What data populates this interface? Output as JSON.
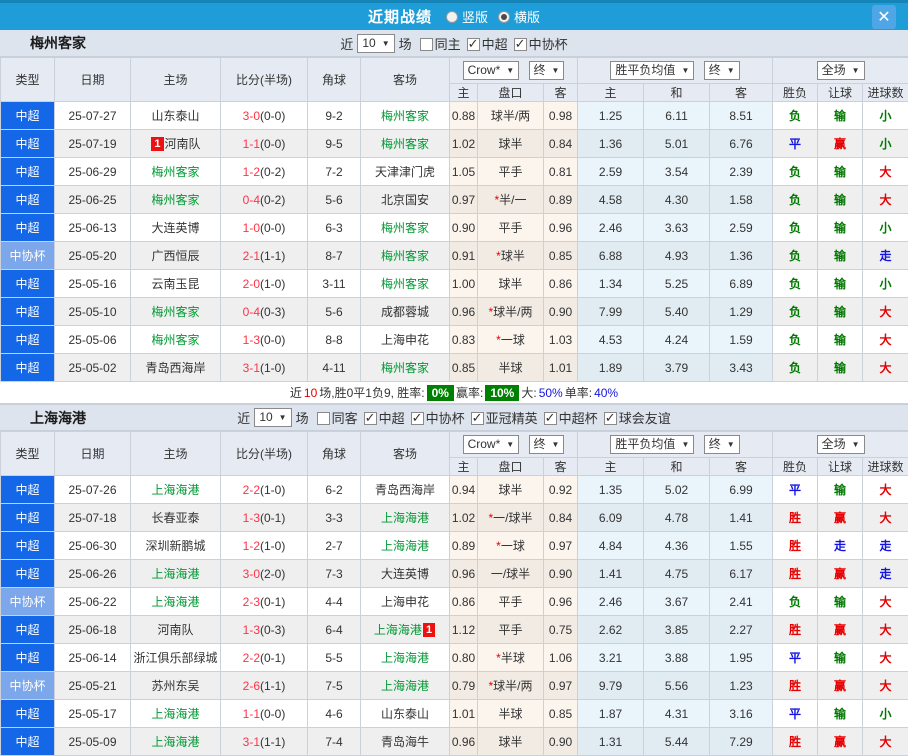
{
  "titlebar": {
    "title": "近期战绩",
    "radios": [
      {
        "label": "竖版",
        "checked": false
      },
      {
        "label": "横版",
        "checked": true
      }
    ],
    "close_glyph": "✕"
  },
  "header": {
    "cols": [
      "类型",
      "日期",
      "主场",
      "比分(半场)",
      "角球",
      "客场"
    ],
    "selects": {
      "company": "Crow*",
      "final1": "终",
      "avg": "胜平负均值",
      "final2": "终",
      "scope": "全场"
    },
    "sub": [
      "主",
      "盘口",
      "客",
      "主",
      "和",
      "客",
      "胜负",
      "让球",
      "进球数"
    ]
  },
  "league_styles": {
    "中超": "league",
    "中协杯": "cup"
  },
  "result_colors": {
    "胜": "#E60000",
    "平": "#1414E0",
    "负": "#007800",
    "赢": "#E60000",
    "输": "#007800",
    "走": "#1414E0",
    "大": "#E60000",
    "小": "#007800"
  },
  "sections": [
    {
      "team": "梅州客家",
      "filters": {
        "near": "近",
        "count": "10",
        "games": "场",
        "checkboxes": [
          {
            "label": "同主",
            "checked": false
          },
          {
            "label": "中超",
            "checked": true
          },
          {
            "label": "中协杯",
            "checked": true
          }
        ]
      },
      "rows": [
        {
          "type": "中超",
          "date": "25-07-27",
          "home": {
            "name": "山东泰山",
            "green": false
          },
          "score": "3-0(0-0)",
          "corner": "9-2",
          "away": {
            "name": "梅州客家",
            "green": true
          },
          "o1": "0.88",
          "pan": "球半/两",
          "o2": "0.98",
          "a1": "1.25",
          "a2": "6.11",
          "a3": "8.51",
          "r1": "负",
          "r2": "输",
          "r3": "小"
        },
        {
          "type": "中超",
          "date": "25-07-19",
          "home": {
            "name": "河南队",
            "green": false,
            "card": "1",
            "card_pos": "before"
          },
          "score": "1-1(0-0)",
          "corner": "9-5",
          "away": {
            "name": "梅州客家",
            "green": true
          },
          "o1": "1.02",
          "pan": "球半",
          "o2": "0.84",
          "a1": "1.36",
          "a2": "5.01",
          "a3": "6.76",
          "r1": "平",
          "r2": "赢",
          "r3": "小"
        },
        {
          "type": "中超",
          "date": "25-06-29",
          "home": {
            "name": "梅州客家",
            "green": true
          },
          "score": "1-2(0-2)",
          "corner": "7-2",
          "away": {
            "name": "天津津门虎",
            "green": false
          },
          "o1": "1.05",
          "pan": "平手",
          "o2": "0.81",
          "a1": "2.59",
          "a2": "3.54",
          "a3": "2.39",
          "r1": "负",
          "r2": "输",
          "r3": "大"
        },
        {
          "type": "中超",
          "date": "25-06-25",
          "home": {
            "name": "梅州客家",
            "green": true
          },
          "score": "0-4(0-2)",
          "corner": "5-6",
          "away": {
            "name": "北京国安",
            "green": false
          },
          "o1": "0.97",
          "pan": "*半/一",
          "o2": "0.89",
          "a1": "4.58",
          "a2": "4.30",
          "a3": "1.58",
          "r1": "负",
          "r2": "输",
          "r3": "大"
        },
        {
          "type": "中超",
          "date": "25-06-13",
          "home": {
            "name": "大连英博",
            "green": false
          },
          "score": "1-0(0-0)",
          "corner": "6-3",
          "away": {
            "name": "梅州客家",
            "green": true
          },
          "o1": "0.90",
          "pan": "平手",
          "o2": "0.96",
          "a1": "2.46",
          "a2": "3.63",
          "a3": "2.59",
          "r1": "负",
          "r2": "输",
          "r3": "小"
        },
        {
          "type": "中协杯",
          "date": "25-05-20",
          "home": {
            "name": "广西恒辰",
            "green": false
          },
          "score": "2-1(1-1)",
          "corner": "8-7",
          "away": {
            "name": "梅州客家",
            "green": true
          },
          "o1": "0.91",
          "pan": "*球半",
          "o2": "0.85",
          "a1": "6.88",
          "a2": "4.93",
          "a3": "1.36",
          "r1": "负",
          "r2": "输",
          "r3": "走"
        },
        {
          "type": "中超",
          "date": "25-05-16",
          "home": {
            "name": "云南玉昆",
            "green": false
          },
          "score": "2-0(1-0)",
          "corner": "3-11",
          "away": {
            "name": "梅州客家",
            "green": true
          },
          "o1": "1.00",
          "pan": "球半",
          "o2": "0.86",
          "a1": "1.34",
          "a2": "5.25",
          "a3": "6.89",
          "r1": "负",
          "r2": "输",
          "r3": "小"
        },
        {
          "type": "中超",
          "date": "25-05-10",
          "home": {
            "name": "梅州客家",
            "green": true
          },
          "score": "0-4(0-3)",
          "corner": "5-6",
          "away": {
            "name": "成都蓉城",
            "green": false
          },
          "o1": "0.96",
          "pan": "*球半/两",
          "o2": "0.90",
          "a1": "7.99",
          "a2": "5.40",
          "a3": "1.29",
          "r1": "负",
          "r2": "输",
          "r3": "大"
        },
        {
          "type": "中超",
          "date": "25-05-06",
          "home": {
            "name": "梅州客家",
            "green": true
          },
          "score": "1-3(0-0)",
          "corner": "8-8",
          "away": {
            "name": "上海申花",
            "green": false
          },
          "o1": "0.83",
          "pan": "*一球",
          "o2": "1.03",
          "a1": "4.53",
          "a2": "4.24",
          "a3": "1.59",
          "r1": "负",
          "r2": "输",
          "r3": "大"
        },
        {
          "type": "中超",
          "date": "25-05-02",
          "home": {
            "name": "青岛西海岸",
            "green": false
          },
          "score": "3-1(1-0)",
          "corner": "4-11",
          "away": {
            "name": "梅州客家",
            "green": true
          },
          "o1": "0.85",
          "pan": "半球",
          "o2": "1.01",
          "a1": "1.89",
          "a2": "3.79",
          "a3": "3.43",
          "r1": "负",
          "r2": "输",
          "r3": "大"
        }
      ],
      "summary": {
        "t1": "近",
        "t2": "10",
        "t3": "场,胜0平1负9, 胜率:",
        "rate1": "0%",
        "t4": "赢率:",
        "rate2": "10%",
        "t5": "大:",
        "rate3": "50%",
        "t6": "单率:",
        "rate4": "40%"
      }
    },
    {
      "team": "上海海港",
      "filters": {
        "near": "近",
        "count": "10",
        "games": "场",
        "checkboxes": [
          {
            "label": "同客",
            "checked": false
          },
          {
            "label": "中超",
            "checked": true
          },
          {
            "label": "中协杯",
            "checked": true
          },
          {
            "label": "亚冠精英",
            "checked": true
          },
          {
            "label": "中超杯",
            "checked": true
          },
          {
            "label": "球会友谊",
            "checked": true
          }
        ]
      },
      "rows": [
        {
          "type": "中超",
          "date": "25-07-26",
          "home": {
            "name": "上海海港",
            "green": true
          },
          "score": "2-2(1-0)",
          "corner": "6-2",
          "away": {
            "name": "青岛西海岸",
            "green": false
          },
          "o1": "0.94",
          "pan": "球半",
          "o2": "0.92",
          "a1": "1.35",
          "a2": "5.02",
          "a3": "6.99",
          "r1": "平",
          "r2": "输",
          "r3": "大"
        },
        {
          "type": "中超",
          "date": "25-07-18",
          "home": {
            "name": "长春亚泰",
            "green": false
          },
          "score": "1-3(0-1)",
          "corner": "3-3",
          "away": {
            "name": "上海海港",
            "green": true
          },
          "o1": "1.02",
          "pan": "*一/球半",
          "o2": "0.84",
          "a1": "6.09",
          "a2": "4.78",
          "a3": "1.41",
          "r1": "胜",
          "r2": "赢",
          "r3": "大"
        },
        {
          "type": "中超",
          "date": "25-06-30",
          "home": {
            "name": "深圳新鹏城",
            "green": false
          },
          "score": "1-2(1-0)",
          "corner": "2-7",
          "away": {
            "name": "上海海港",
            "green": true
          },
          "o1": "0.89",
          "pan": "*一球",
          "o2": "0.97",
          "a1": "4.84",
          "a2": "4.36",
          "a3": "1.55",
          "r1": "胜",
          "r2": "走",
          "r3": "走"
        },
        {
          "type": "中超",
          "date": "25-06-26",
          "home": {
            "name": "上海海港",
            "green": true
          },
          "score": "3-0(2-0)",
          "corner": "7-3",
          "away": {
            "name": "大连英博",
            "green": false
          },
          "o1": "0.96",
          "pan": "一/球半",
          "o2": "0.90",
          "a1": "1.41",
          "a2": "4.75",
          "a3": "6.17",
          "r1": "胜",
          "r2": "赢",
          "r3": "走"
        },
        {
          "type": "中协杯",
          "date": "25-06-22",
          "home": {
            "name": "上海海港",
            "green": true
          },
          "score": "2-3(0-1)",
          "corner": "4-4",
          "away": {
            "name": "上海申花",
            "green": false
          },
          "o1": "0.86",
          "pan": "平手",
          "o2": "0.96",
          "a1": "2.46",
          "a2": "3.67",
          "a3": "2.41",
          "r1": "负",
          "r2": "输",
          "r3": "大"
        },
        {
          "type": "中超",
          "date": "25-06-18",
          "home": {
            "name": "河南队",
            "green": false
          },
          "score": "1-3(0-3)",
          "corner": "6-4",
          "away": {
            "name": "上海海港",
            "green": true,
            "card": "1",
            "card_pos": "after"
          },
          "o1": "1.12",
          "pan": "平手",
          "o2": "0.75",
          "a1": "2.62",
          "a2": "3.85",
          "a3": "2.27",
          "r1": "胜",
          "r2": "赢",
          "r3": "大"
        },
        {
          "type": "中超",
          "date": "25-06-14",
          "home": {
            "name": "浙江俱乐部绿城",
            "green": false
          },
          "score": "2-2(0-1)",
          "corner": "5-5",
          "away": {
            "name": "上海海港",
            "green": true
          },
          "o1": "0.80",
          "pan": "*半球",
          "o2": "1.06",
          "a1": "3.21",
          "a2": "3.88",
          "a3": "1.95",
          "r1": "平",
          "r2": "输",
          "r3": "大"
        },
        {
          "type": "中协杯",
          "date": "25-05-21",
          "home": {
            "name": "苏州东吴",
            "green": false
          },
          "score": "2-6(1-1)",
          "corner": "7-5",
          "away": {
            "name": "上海海港",
            "green": true
          },
          "o1": "0.79",
          "pan": "*球半/两",
          "o2": "0.97",
          "a1": "9.79",
          "a2": "5.56",
          "a3": "1.23",
          "r1": "胜",
          "r2": "赢",
          "r3": "大"
        },
        {
          "type": "中超",
          "date": "25-05-17",
          "home": {
            "name": "上海海港",
            "green": true
          },
          "score": "1-1(0-0)",
          "corner": "4-6",
          "away": {
            "name": "山东泰山",
            "green": false
          },
          "o1": "1.01",
          "pan": "半球",
          "o2": "0.85",
          "a1": "1.87",
          "a2": "4.31",
          "a3": "3.16",
          "r1": "平",
          "r2": "输",
          "r3": "小"
        },
        {
          "type": "中超",
          "date": "25-05-09",
          "home": {
            "name": "上海海港",
            "green": true
          },
          "score": "3-1(1-1)",
          "corner": "7-4",
          "away": {
            "name": "青岛海牛",
            "green": false
          },
          "o1": "0.96",
          "pan": "球半",
          "o2": "0.90",
          "a1": "1.31",
          "a2": "5.44",
          "a3": "7.29",
          "r1": "胜",
          "r2": "赢",
          "r3": "大"
        }
      ]
    }
  ]
}
